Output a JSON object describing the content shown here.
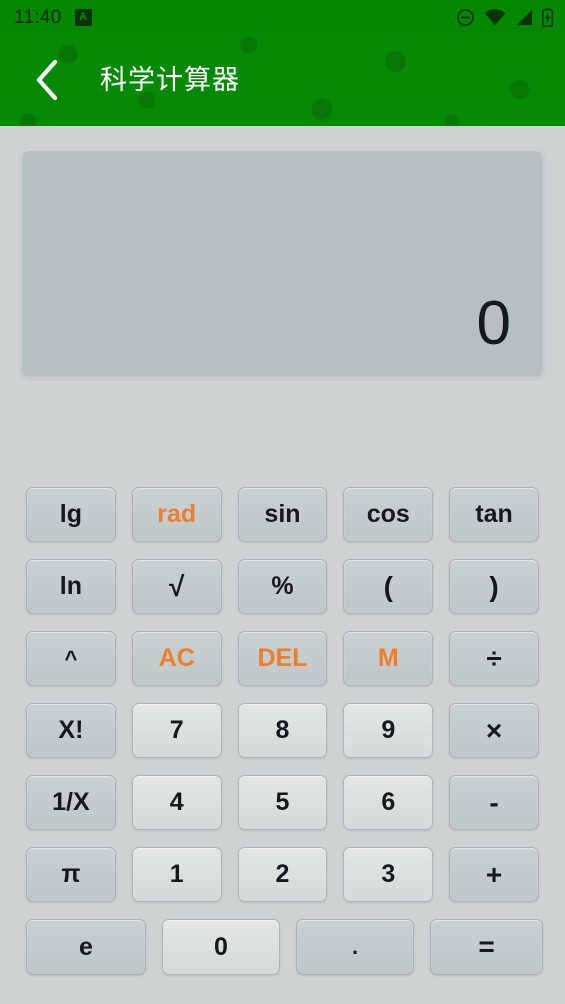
{
  "statusbar": {
    "time": "11:40",
    "badge_label": "A",
    "icons": [
      "do-not-disturb-icon",
      "wifi-icon",
      "cellular-signal-icon",
      "battery-charging-icon"
    ]
  },
  "header": {
    "back_icon": "chevron-left-icon",
    "title": "科学计算器",
    "background_color": "#068905"
  },
  "display": {
    "value": "0",
    "background_color": "#b6c0c1"
  },
  "theme": {
    "page_background": "#ced2d3",
    "accent_color": "#ee7e2c",
    "key_background": "#c4cccd",
    "digit_key_background": "#dcdede",
    "key_text_color": "#15191b"
  },
  "keypad": {
    "rows": [
      [
        {
          "label": "lg",
          "kind": "function"
        },
        {
          "label": "rad",
          "kind": "accent"
        },
        {
          "label": "sin",
          "kind": "function"
        },
        {
          "label": "cos",
          "kind": "function"
        },
        {
          "label": "tan",
          "kind": "function"
        }
      ],
      [
        {
          "label": "ln",
          "kind": "function"
        },
        {
          "label": "√",
          "kind": "function"
        },
        {
          "label": "%",
          "kind": "function"
        },
        {
          "label": "(",
          "kind": "function"
        },
        {
          "label": ")",
          "kind": "function"
        }
      ],
      [
        {
          "label": "^",
          "kind": "function"
        },
        {
          "label": "AC",
          "kind": "accent"
        },
        {
          "label": "DEL",
          "kind": "accent"
        },
        {
          "label": "M",
          "kind": "accent"
        },
        {
          "label": "÷",
          "kind": "function"
        }
      ],
      [
        {
          "label": "X!",
          "kind": "function"
        },
        {
          "label": "7",
          "kind": "digit"
        },
        {
          "label": "8",
          "kind": "digit"
        },
        {
          "label": "9",
          "kind": "digit"
        },
        {
          "label": "×",
          "kind": "function"
        }
      ],
      [
        {
          "label": "1/X",
          "kind": "function"
        },
        {
          "label": "4",
          "kind": "digit"
        },
        {
          "label": "5",
          "kind": "digit"
        },
        {
          "label": "6",
          "kind": "digit"
        },
        {
          "label": "-",
          "kind": "function"
        }
      ],
      [
        {
          "label": "π",
          "kind": "function"
        },
        {
          "label": "1",
          "kind": "digit"
        },
        {
          "label": "2",
          "kind": "digit"
        },
        {
          "label": "3",
          "kind": "digit"
        },
        {
          "label": "+",
          "kind": "function"
        }
      ],
      [
        {
          "label": "e",
          "kind": "function"
        },
        {
          "label": "0",
          "kind": "digit"
        },
        {
          "label": ".",
          "kind": "function"
        },
        {
          "label": "=",
          "kind": "function"
        }
      ]
    ]
  }
}
